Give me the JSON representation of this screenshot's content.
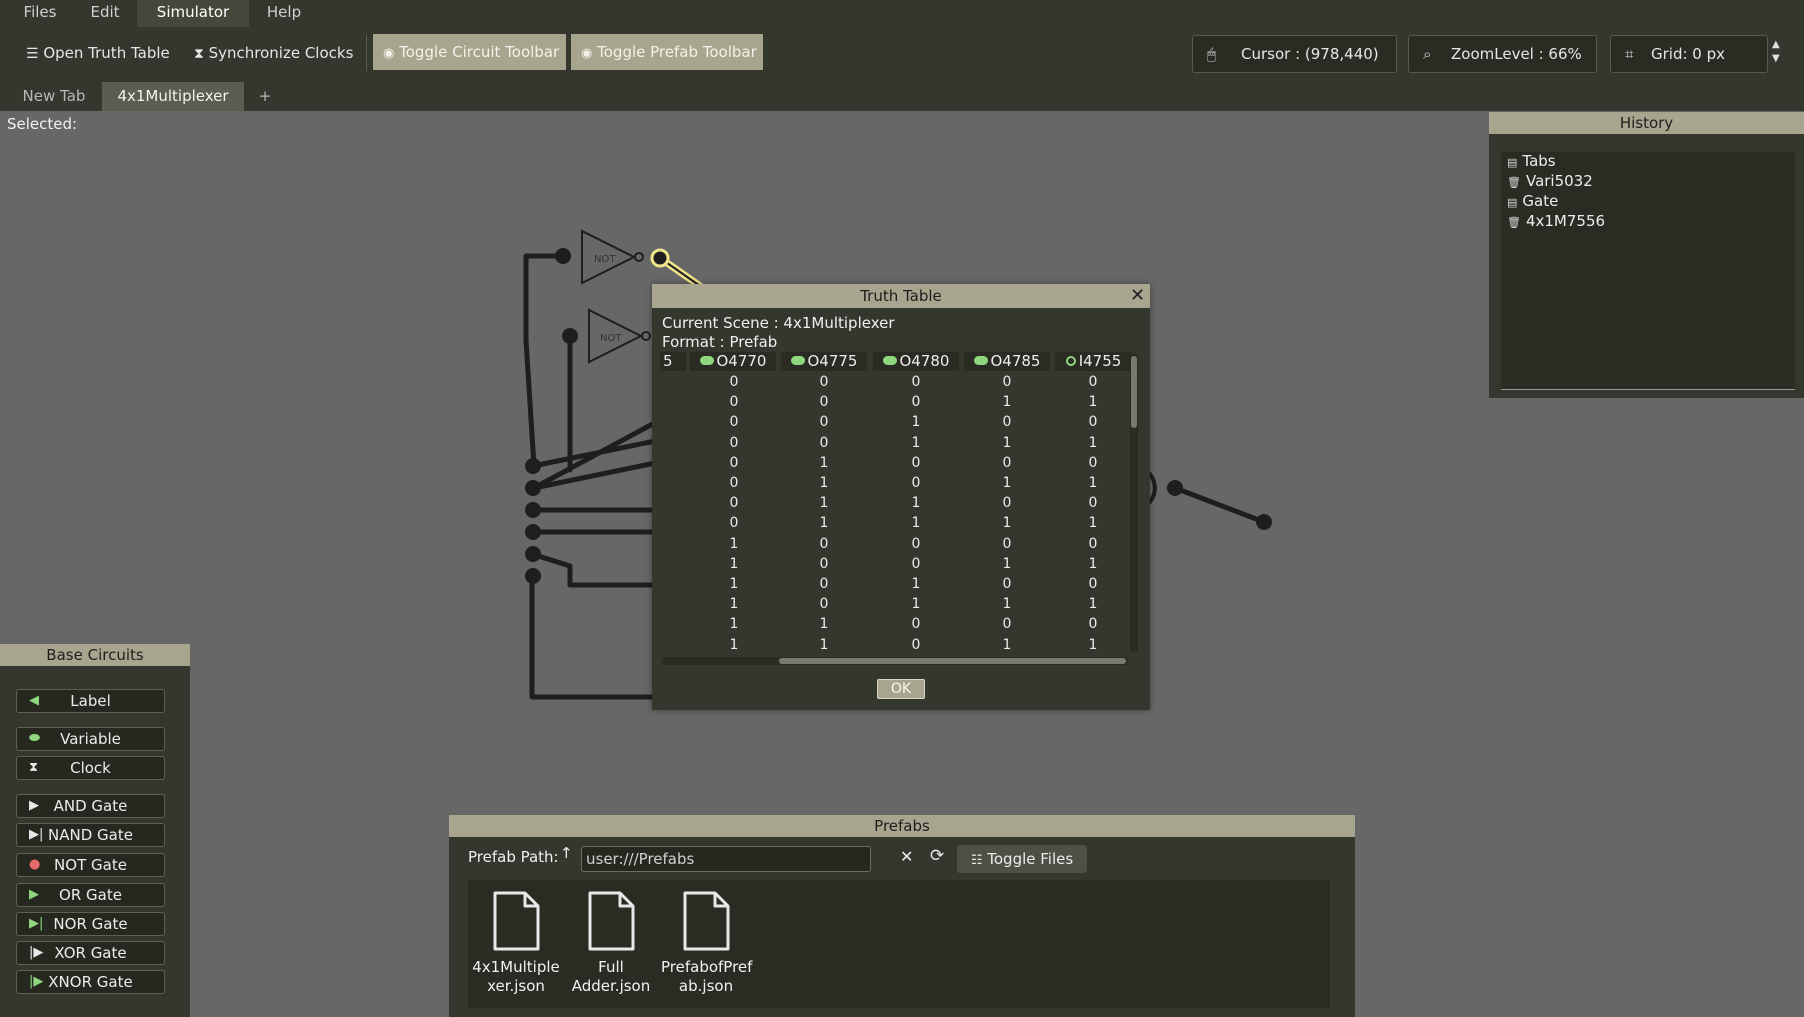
{
  "menu": [
    "Files",
    "Edit",
    "Simulator",
    "Help"
  ],
  "toolbar": {
    "open_truth_table": "Open Truth Table",
    "synchronize_clocks": "Synchronize Clocks",
    "toggle_circuit_toolbar": "Toggle Circuit Toolbar",
    "toggle_prefab_toolbar": "Toggle Prefab Toolbar",
    "cursor": "Cursor : (978,440)",
    "zoom": "ZoomLevel : 66%",
    "grid": "Grid:  0 px"
  },
  "tabs": [
    "New Tab",
    "4x1Multiplexer",
    "+"
  ],
  "selected_label": "Selected:",
  "gates": {
    "not_label": "NOT"
  },
  "base_circuits": {
    "title": "Base Circuits",
    "items": [
      "Label",
      "Variable",
      "Clock",
      "AND Gate",
      "NAND Gate",
      "NOT Gate",
      "OR Gate",
      "NOR Gate",
      "XOR Gate",
      "XNOR Gate"
    ]
  },
  "history": {
    "title": "History",
    "items": [
      "Tabs",
      "Vari5032",
      "Gate",
      "4x1M7556"
    ]
  },
  "truth_table": {
    "title": "Truth Table",
    "scene": "Current Scene : 4x1Multiplexer",
    "format": "Format : Prefab",
    "first_col_fragment": "5",
    "columns": [
      "O4770",
      "O4775",
      "O4780",
      "O4785",
      "I4755"
    ],
    "rows": [
      [
        0,
        0,
        0,
        0,
        0
      ],
      [
        0,
        0,
        0,
        1,
        1
      ],
      [
        0,
        0,
        1,
        0,
        0
      ],
      [
        0,
        0,
        1,
        1,
        1
      ],
      [
        0,
        1,
        0,
        0,
        0
      ],
      [
        0,
        1,
        0,
        1,
        1
      ],
      [
        0,
        1,
        1,
        0,
        0
      ],
      [
        0,
        1,
        1,
        1,
        1
      ],
      [
        1,
        0,
        0,
        0,
        0
      ],
      [
        1,
        0,
        0,
        1,
        1
      ],
      [
        1,
        0,
        1,
        0,
        0
      ],
      [
        1,
        0,
        1,
        1,
        1
      ],
      [
        1,
        1,
        0,
        0,
        0
      ],
      [
        1,
        1,
        0,
        1,
        1
      ]
    ],
    "ok_label": "OK"
  },
  "prefabs": {
    "title": "Prefabs",
    "path_label": "Prefab Path:",
    "path_value": "user:///Prefabs",
    "toggle_files": "Toggle Files",
    "files": [
      {
        "line1": "4x1Multiple",
        "line2": "xer.json"
      },
      {
        "line1": "Full",
        "line2": "Adder.json"
      },
      {
        "line1": "PrefabofPref",
        "line2": "ab.json"
      }
    ]
  },
  "colors": {
    "panel_bg": "#34372d",
    "accent": "#a8a58e",
    "canvas": "#676767",
    "variable_green": "#8fd67f",
    "selection_yellow": "#f0e68c"
  }
}
